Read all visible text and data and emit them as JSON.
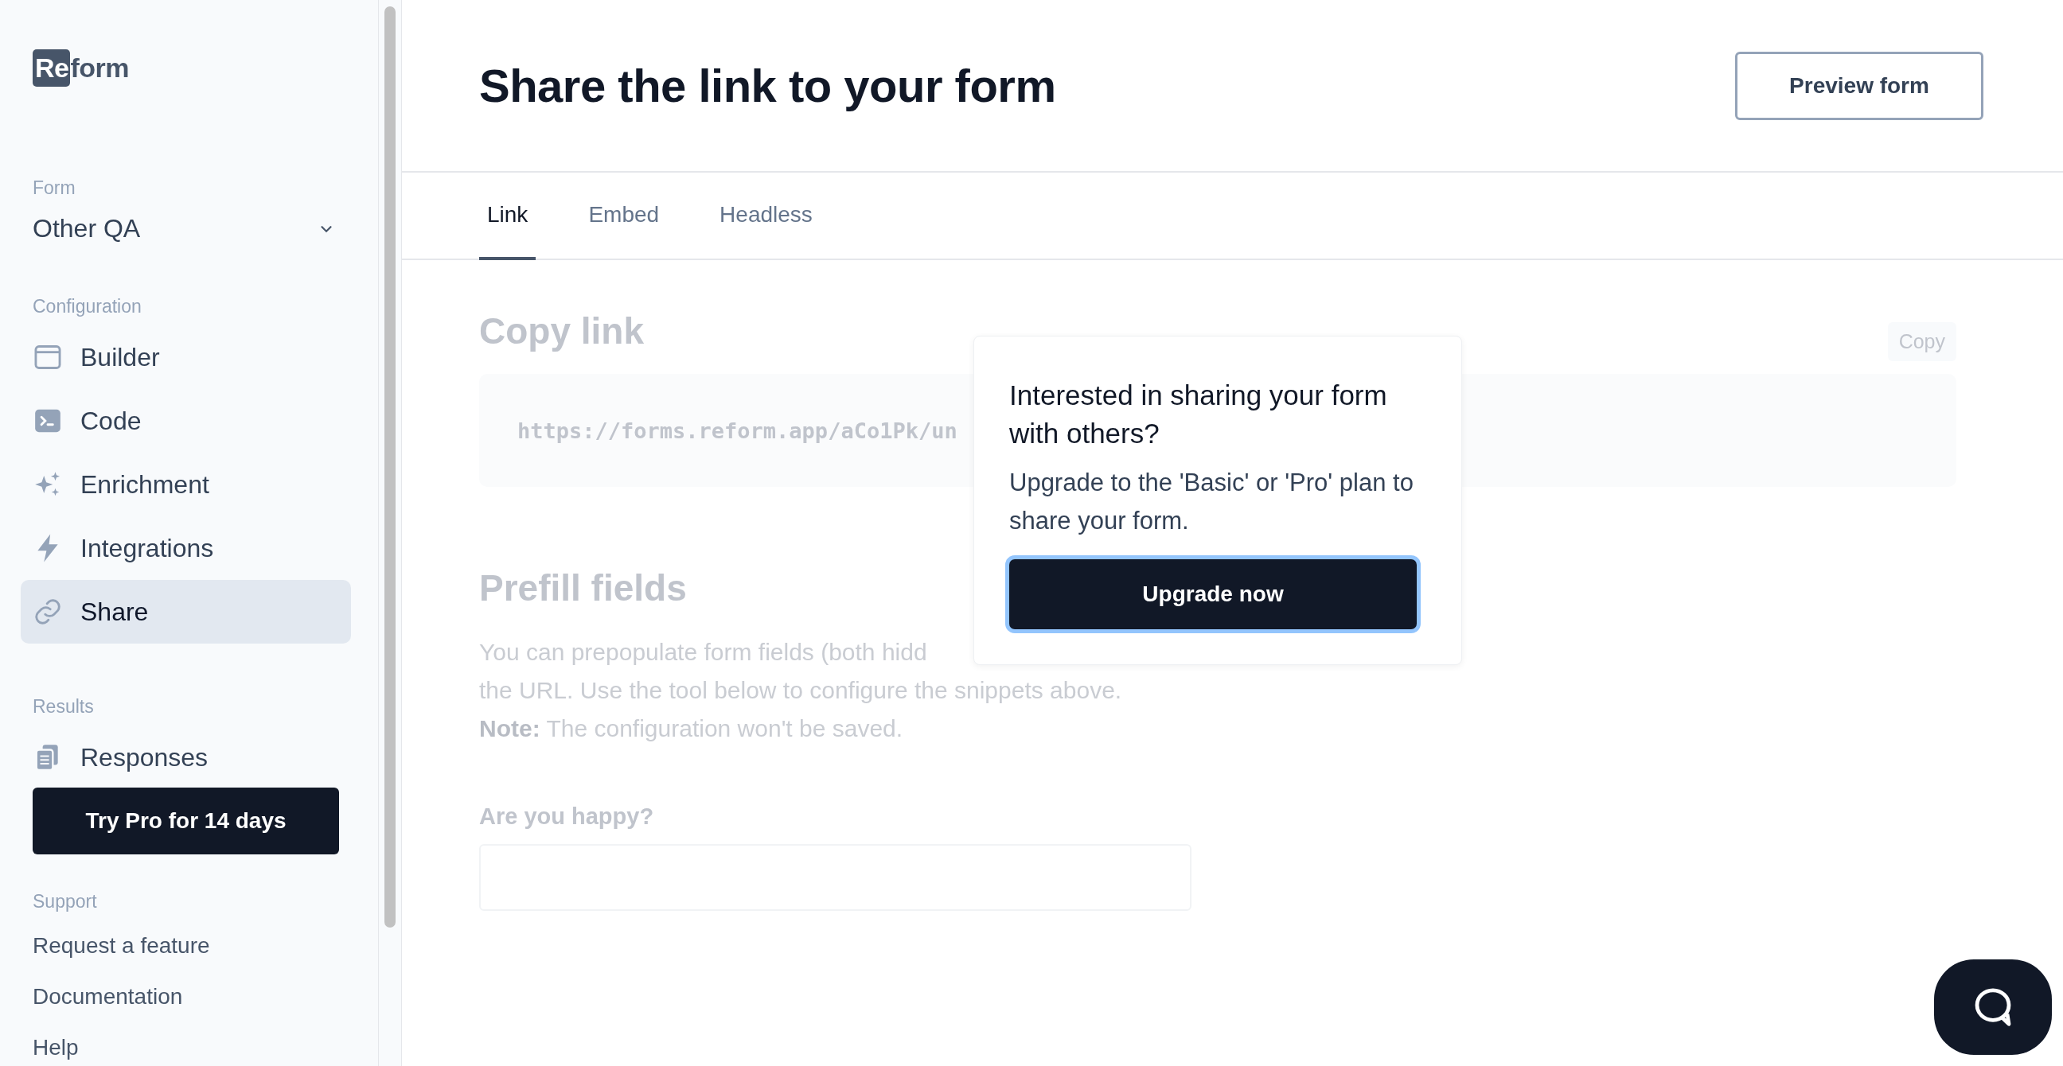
{
  "logo": {
    "mark": "Re",
    "word": "form"
  },
  "sidebar": {
    "form_label": "Form",
    "form_name": "Other QA",
    "sections": [
      {
        "title": "Configuration",
        "items": [
          {
            "label": "Builder",
            "selected": false
          },
          {
            "label": "Code",
            "selected": false
          },
          {
            "label": "Enrichment",
            "selected": false
          },
          {
            "label": "Integrations",
            "selected": false
          },
          {
            "label": "Share",
            "selected": true
          }
        ]
      },
      {
        "title": "Results",
        "items": [
          {
            "label": "Responses",
            "selected": false
          }
        ],
        "cta": "Try Pro for 14 days"
      },
      {
        "title": "Support",
        "links": [
          "Request a feature",
          "Documentation",
          "Help"
        ]
      }
    ]
  },
  "header": {
    "title": "Share the link to your form",
    "button": "Preview form"
  },
  "tabs": [
    {
      "label": "Link",
      "selected": true
    },
    {
      "label": "Embed",
      "selected": false
    },
    {
      "label": "Headless",
      "selected": false
    }
  ],
  "copy_link": {
    "title": "Copy link",
    "button": "Copy",
    "url": "https://forms.reform.app/aCo1Pk/un"
  },
  "prefill": {
    "title": "Prefill fields",
    "line_1": "You can prepopulate form fields (both hidd",
    "line_2": "the URL. Use the tool below to configure the snippets above.",
    "note": "**Note:** The configuration won't be saved.",
    "field_label": "Are you happy?"
  },
  "popup": {
    "title": "Interested in sharing your form with others?",
    "text": "Upgrade to the 'Basic' or 'Pro' plan to share your form.",
    "button": "Upgrade now"
  }
}
